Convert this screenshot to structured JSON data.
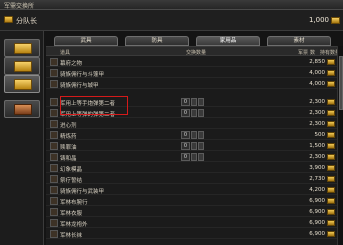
{
  "window": {
    "title": "军需交换所"
  },
  "header": {
    "name": "分队长",
    "money": "1,000"
  },
  "tabs": [
    "武具",
    "防具",
    "家用品",
    "素材"
  ],
  "columns": {
    "item": "道具",
    "exchange_qty": "交换数量",
    "price": "军票",
    "count": "数",
    "owned": "持有数量"
  },
  "items": [
    {
      "name": "幕府之物",
      "price": "2,850"
    },
    {
      "name": "骑族佣行与斗篷甲",
      "price": "4,000"
    },
    {
      "name": "骑族佣行与城甲",
      "price": "4,000"
    },
    {
      "name": "军用上等手炮弹第二者",
      "qty": "0",
      "price": "2,300"
    },
    {
      "name": "军用上等弹的弹第二者",
      "qty": "0",
      "price": "2,300"
    },
    {
      "name": "进心剂",
      "price": "2,300"
    },
    {
      "name": "精炼药",
      "qty": "0",
      "price": "500"
    },
    {
      "name": "赎罪油",
      "qty": "0",
      "price": "1,500"
    },
    {
      "name": "铸和晶",
      "qty": "0",
      "price": "2,300"
    },
    {
      "name": "幻象模晶",
      "price": "3,900"
    },
    {
      "name": "祭疗誓结",
      "price": "2,730"
    },
    {
      "name": "骑族佣行与武装甲",
      "price": "4,200"
    },
    {
      "name": "军林布腕行",
      "price": "6,900"
    },
    {
      "name": "军林衣服",
      "price": "6,900"
    },
    {
      "name": "军林龙袍外",
      "price": "6,900"
    },
    {
      "name": "军林长袜",
      "price": "6,900"
    }
  ]
}
